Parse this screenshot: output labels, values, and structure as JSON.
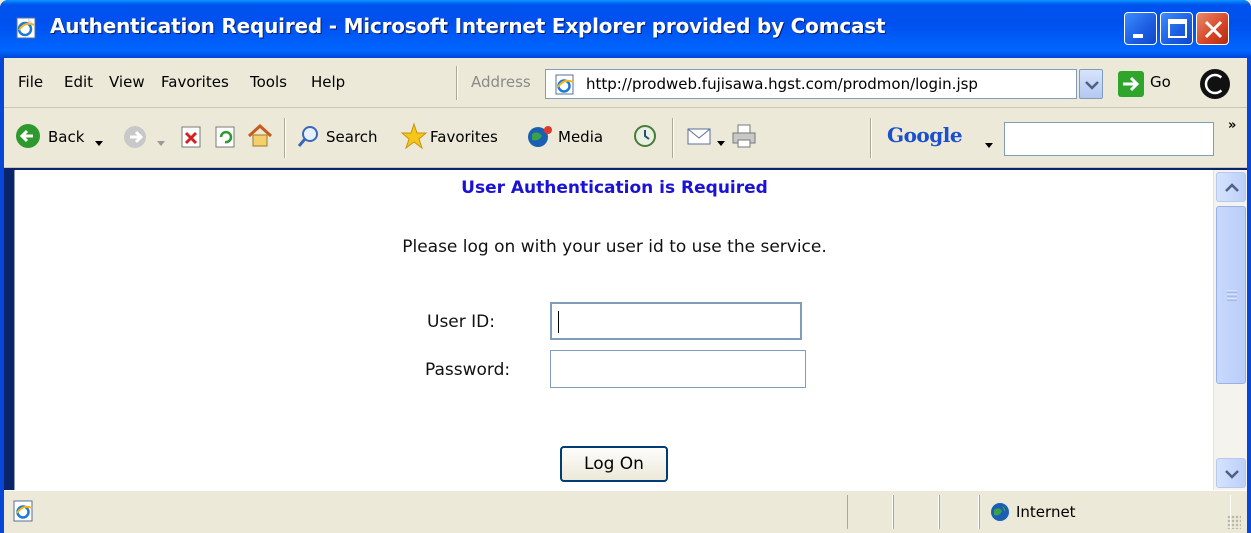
{
  "window": {
    "title": "Authentication Required - Microsoft Internet Explorer provided by Comcast",
    "icon": "ie-page-icon",
    "controls": [
      "minimize",
      "maximize",
      "close"
    ]
  },
  "menubar": {
    "items": [
      "File",
      "Edit",
      "View",
      "Favorites",
      "Tools",
      "Help"
    ],
    "address_label": "Address",
    "address_value": "http://prodweb.fujisawa.hgst.com/prodmon/login.jsp",
    "go_label": "Go"
  },
  "toolbar": {
    "back_label": "Back",
    "search_label": "Search",
    "favorites_label": "Favorites",
    "media_label": "Media",
    "google_label": "Google",
    "google_search_value": ""
  },
  "page": {
    "heading": "User Authentication is Required",
    "instructions": "Please log on with your user id to use the service.",
    "user_id_label": "User ID:",
    "user_id_value": "",
    "password_label": "Password:",
    "password_value": "",
    "logon_label": "Log On"
  },
  "statusbar": {
    "zone_label": "Internet"
  },
  "colors": {
    "title_bar": "#0053ee",
    "heading_text": "#1a12d6",
    "close_button": "#d54424"
  }
}
